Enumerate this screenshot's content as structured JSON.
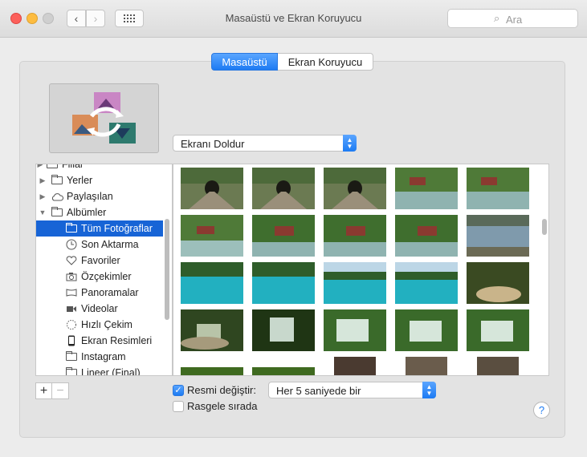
{
  "window": {
    "title": "Masaüstü ve Ekran Koruyucu"
  },
  "search": {
    "placeholder": "Ara"
  },
  "tabs": {
    "desktop": "Masaüstü",
    "screensaver": "Ekran Koruyucu"
  },
  "fill_popup": {
    "value": "Ekranı Doldur"
  },
  "sidebar": {
    "items": [
      {
        "label": "Yerler",
        "icon": "folder-icon"
      },
      {
        "label": "Paylaşılan",
        "icon": "cloud-icon"
      },
      {
        "label": "Albümler",
        "icon": "folder-icon"
      },
      {
        "label": "Tüm Fotoğraflar",
        "icon": "album-icon"
      },
      {
        "label": "Son Aktarma",
        "icon": "clock-icon"
      },
      {
        "label": "Favoriler",
        "icon": "heart-icon"
      },
      {
        "label": "Özçekimler",
        "icon": "camera-icon"
      },
      {
        "label": "Panoramalar",
        "icon": "panorama-icon"
      },
      {
        "label": "Videolar",
        "icon": "video-icon"
      },
      {
        "label": "Hızlı Çekim",
        "icon": "burst-icon"
      },
      {
        "label": "Ekran Resimleri",
        "icon": "phone-icon"
      },
      {
        "label": "Instagram",
        "icon": "album-icon"
      },
      {
        "label": "Lineer (Final)",
        "icon": "album-icon"
      }
    ],
    "partial_top": "Fillar"
  },
  "controls": {
    "change_picture_label": "Resmi değiştir:",
    "change_picture_checked": true,
    "interval_value": "Her 5 saniyede bir",
    "random_label": "Rasgele sırada",
    "random_checked": false,
    "add": "+",
    "remove": "−",
    "help": "?"
  },
  "colors": {
    "accent": "#1d7bf3",
    "selection": "#1764d6"
  }
}
